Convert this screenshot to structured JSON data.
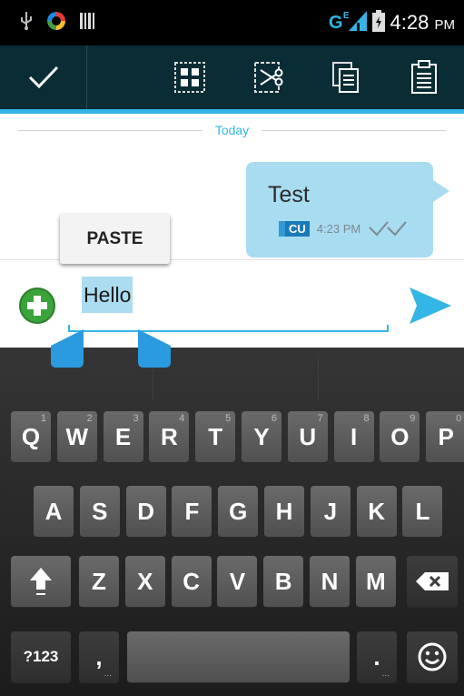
{
  "status_bar": {
    "time": "4:28",
    "ampm": "PM",
    "network": "G",
    "network_sub": "E"
  },
  "conversation": {
    "date_separator": "Today",
    "message": {
      "text": "Test",
      "badge": "CU",
      "time": "4:23 PM"
    }
  },
  "context_popup": {
    "paste_label": "PASTE"
  },
  "compose": {
    "input_value": "Hello"
  },
  "keyboard": {
    "row1": [
      {
        "label": "Q",
        "hint": "1"
      },
      {
        "label": "W",
        "hint": "2"
      },
      {
        "label": "E",
        "hint": "3"
      },
      {
        "label": "R",
        "hint": "4"
      },
      {
        "label": "T",
        "hint": "5"
      },
      {
        "label": "Y",
        "hint": "6"
      },
      {
        "label": "U",
        "hint": "7"
      },
      {
        "label": "I",
        "hint": "8"
      },
      {
        "label": "O",
        "hint": "9"
      },
      {
        "label": "P",
        "hint": "0"
      }
    ],
    "row2": [
      "A",
      "S",
      "D",
      "F",
      "G",
      "H",
      "J",
      "K",
      "L"
    ],
    "row3": [
      "Z",
      "X",
      "C",
      "V",
      "B",
      "N",
      "M"
    ],
    "symbols_label": "?123",
    "comma_label": ",",
    "period_label": ".",
    "sub_hint": "..."
  },
  "colors": {
    "accent": "#33b5e5",
    "action_bar": "#0a2c35",
    "bubble": "#a8dcf1"
  }
}
